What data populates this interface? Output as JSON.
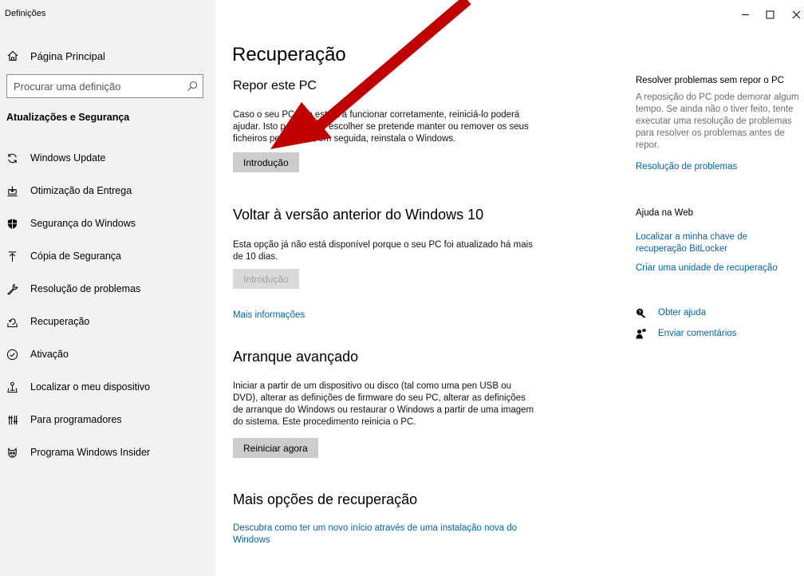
{
  "window": {
    "title": "Definições",
    "controls": [
      "minimize",
      "maximize",
      "close"
    ]
  },
  "sidebar": {
    "home_label": "Página Principal",
    "search_placeholder": "Procurar uma definição",
    "section_title": "Atualizações e Segurança",
    "items": [
      {
        "label": "Windows Update",
        "icon": "refresh-icon"
      },
      {
        "label": "Otimização da Entrega",
        "icon": "delivery-optimization-icon"
      },
      {
        "label": "Segurança do Windows",
        "icon": "shield-icon"
      },
      {
        "label": "Cópia de Segurança",
        "icon": "backup-icon"
      },
      {
        "label": "Resolução de problemas",
        "icon": "wrench-icon"
      },
      {
        "label": "Recuperação",
        "icon": "recovery-icon"
      },
      {
        "label": "Ativação",
        "icon": "activation-check-icon"
      },
      {
        "label": "Localizar o meu dispositivo",
        "icon": "find-device-icon"
      },
      {
        "label": "Para programadores",
        "icon": "developer-icon"
      },
      {
        "label": "Programa Windows Insider",
        "icon": "insider-icon"
      }
    ]
  },
  "main": {
    "title": "Recuperação",
    "reset": {
      "heading": "Repor este PC",
      "description": "Caso o seu PC não esteja a funcionar corretamente, reiniciá-lo poderá ajudar. Isto permite-lhe escolher se pretende manter ou remover os seus ficheiros pessoais e, em seguida, reinstala o Windows.",
      "button": "Introdução"
    },
    "go_back": {
      "heading": "Voltar à versão anterior do Windows 10",
      "description": "Esta opção já não está disponível porque o seu PC foi atualizado há mais de 10 dias.",
      "button": "Introdução",
      "link": "Mais informações"
    },
    "advanced": {
      "heading": "Arranque avançado",
      "description": "Iniciar a partir de um dispositivo ou disco (tal como uma pen USB ou DVD), alterar as definições de firmware do seu PC, alterar as definições de arranque do Windows ou restaurar o Windows a partir de uma imagem do sistema. Este procedimento reinicia o PC.",
      "button": "Reiniciar agora"
    },
    "more": {
      "heading": "Mais opções de recuperação",
      "link": "Descubra como ter um novo início através de uma instalação nova do Windows"
    }
  },
  "right_panel": {
    "troubleshoot": {
      "title": "Resolver problemas sem repor o PC",
      "text": "A reposição do PC pode demorar algum tempo. Se ainda não o tiver feito, tente executar uma resolução de problemas para resolver os problemas antes de repor.",
      "link": "Resolução de problemas"
    },
    "web_help": {
      "title": "Ajuda na Web",
      "links": [
        "Localizar a minha chave de recuperação BitLocker",
        "Criar uma unidade de recuperação"
      ]
    },
    "get_help": "Obter ajuda",
    "feedback": "Enviar comentários"
  },
  "colors": {
    "accent": "#0063b1",
    "sidebar_bg": "#f2f2f2",
    "button_bg": "#cccccc",
    "annotation_arrow": "#c00000"
  }
}
